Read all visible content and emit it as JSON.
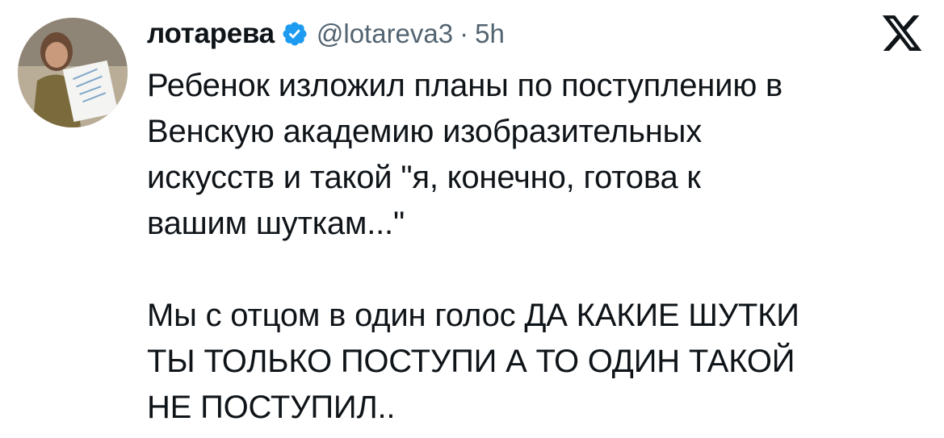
{
  "tweet": {
    "author": {
      "display_name": "лотарева",
      "handle": "@lotareva3",
      "verified": true,
      "avatar": "profile-photo"
    },
    "separator": "·",
    "time": "5h",
    "platform_icon": "x-logo-icon",
    "paragraphs": [
      "Ребенок изложил планы по поступлению в\nВенскую академию изобразительных\nискусств и такой \"я, конечно, готова к\nвашим шуткам...\"",
      "Мы с отцом в один голос ДА КАКИЕ ШУТКИ\nТЫ ТОЛЬКО ПОСТУПИ А ТО ОДИН ТАКОЙ\nНЕ ПОСТУПИЛ.."
    ]
  },
  "colors": {
    "text": "#0f1419",
    "secondary": "#536471",
    "verified": "#1d9bf0",
    "background": "#ffffff"
  }
}
